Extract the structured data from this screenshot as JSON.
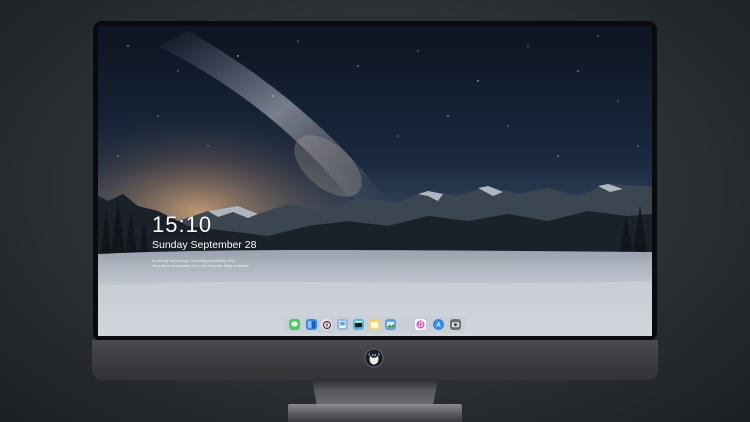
{
  "lock_screen": {
    "time": "15:10",
    "date": "Sunday September 28",
    "tagline_line1": "Inventing technology. Enriching possibility. Win.",
    "tagline_line2": "Your ideal companion for a rich time life. Now available"
  },
  "dock": {
    "items": [
      {
        "name": "messages",
        "color": "#3fcf5a"
      },
      {
        "name": "finder",
        "color": "#2f8bf0"
      },
      {
        "name": "safari",
        "color": "#e8e8ea"
      },
      {
        "name": "preview",
        "color": "#88b9e0"
      },
      {
        "name": "finalcut",
        "color": "#3bbfe6"
      },
      {
        "name": "notes",
        "color": "#f6d65a"
      },
      {
        "name": "photos-gallery",
        "color": "#5aa3e0"
      },
      {
        "name": "itunes",
        "color": "#e64ec8"
      },
      {
        "name": "appstore",
        "color": "#2f8bf0"
      },
      {
        "name": "photo-booth",
        "color": "#6d6f74"
      }
    ]
  },
  "colors": {
    "sky_top": "#0e1626",
    "sky_glow": "#c99a6e",
    "snow": "#c7ccd3",
    "bezel": "#0b0b0d",
    "chin": "#3e3f43"
  }
}
